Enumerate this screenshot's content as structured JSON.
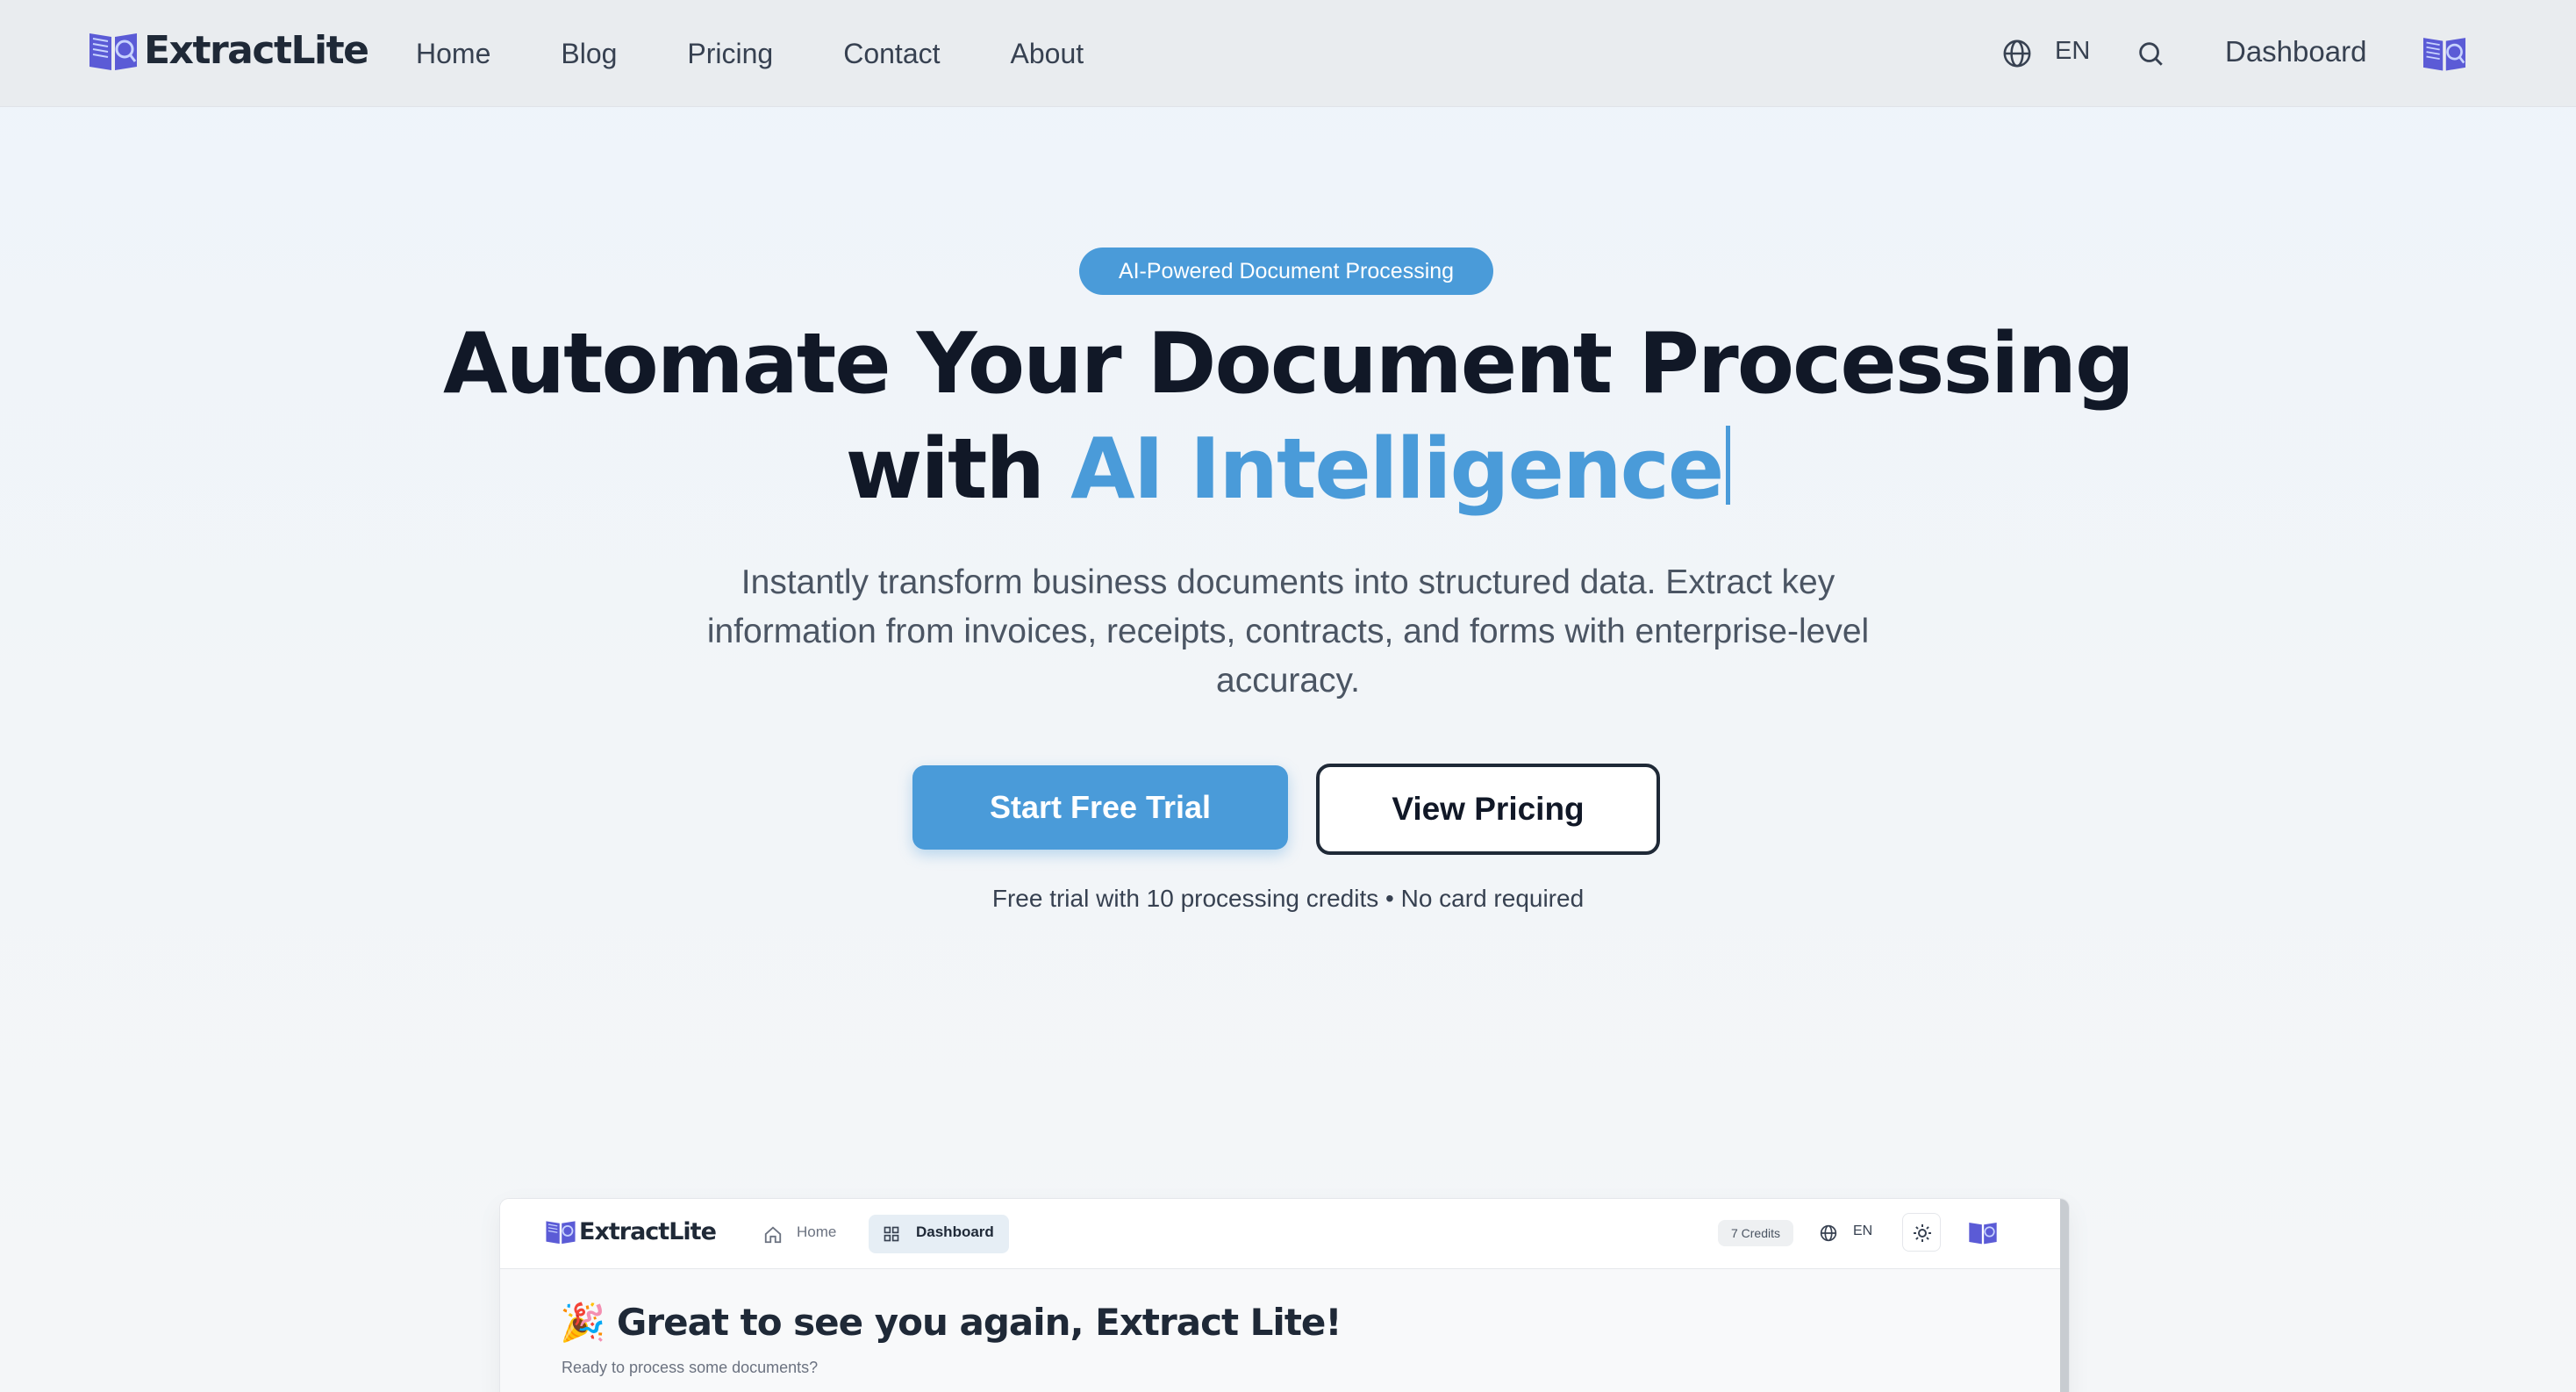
{
  "nav": {
    "brand": "ExtractLite",
    "links": [
      "Home",
      "Blog",
      "Pricing",
      "Contact",
      "About"
    ],
    "language": "EN",
    "dashboard_label": "Dashboard"
  },
  "hero": {
    "badge": "AI-Powered Document Processing",
    "headline_line1": "Automate Your Document Processing",
    "headline_line2_prefix": "with ",
    "headline_line2_accent": "AI Intelligence",
    "subtitle": "Instantly transform business documents into structured data. Extract key information from invoices, receipts, contracts, and forms with enterprise-level accuracy.",
    "primary_cta": "Start Free Trial",
    "secondary_cta": "View Pricing",
    "note": "Free trial with 10 processing credits • No card required"
  },
  "preview": {
    "brand": "ExtractLite",
    "home_label": "Home",
    "dashboard_label": "Dashboard",
    "credits": "7 Credits",
    "language": "EN",
    "greeting": "🎉 Great to see you again, Extract Lite!",
    "subtext": "Ready to process some documents?"
  },
  "colors": {
    "accent": "#4a9bd9",
    "brand_icon": "#5b5bd6",
    "text_dark": "#111827"
  }
}
